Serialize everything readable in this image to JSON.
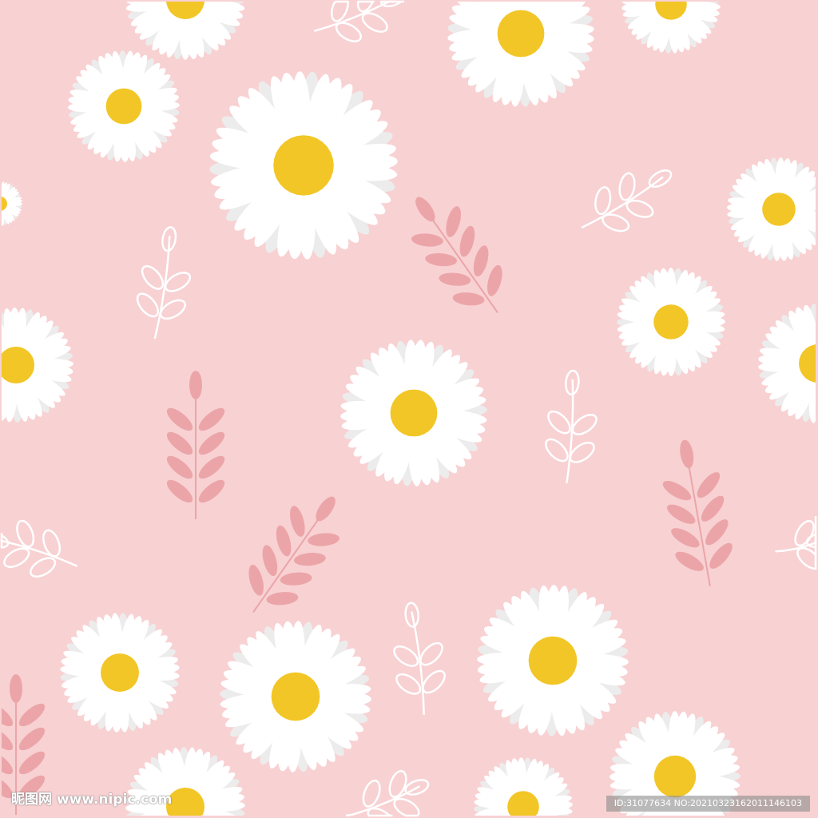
{
  "colors": {
    "background": "#f8d1d3",
    "petal": "#ffffff",
    "petal_shade": "#ececec",
    "center": "#f2c626",
    "leaf_pink": "#eba5a8",
    "leaf_white": "#ffffff"
  },
  "watermark": {
    "site": "昵图网 www.nipic.com",
    "id_text": "ID:31077634 NO:20210323162011146103"
  }
}
